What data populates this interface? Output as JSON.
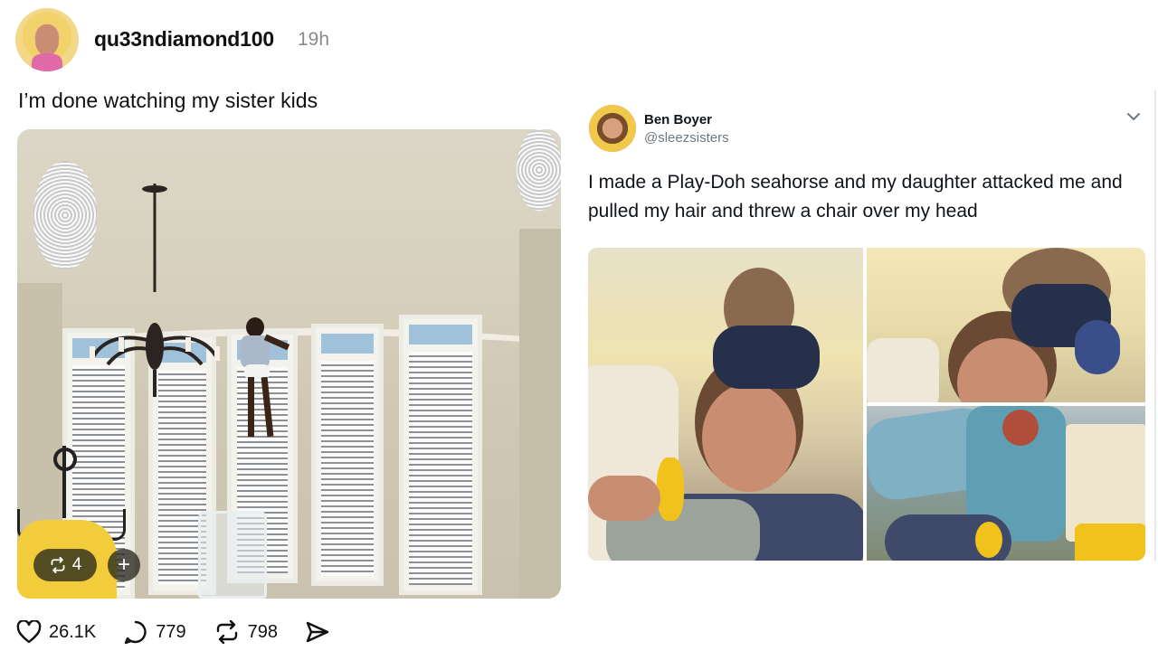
{
  "left_post": {
    "username": "qu33ndiamond100",
    "timestamp": "19h",
    "text": "I’m done watching my sister kids",
    "media_chip_reposts": "4",
    "media_chip_plus": "+",
    "actions": {
      "likes": "26.1K",
      "replies": "779",
      "reposts": "798"
    }
  },
  "right_tweet": {
    "display_name": "Ben Boyer",
    "handle": "@sleezsisters",
    "text": "I made a Play-Doh seahorse and my daughter attacked me and pulled my hair and threw a chair over my head"
  },
  "icons": {
    "like": "heart-icon",
    "reply": "speech-bubble-icon",
    "repost": "repost-arrows-icon",
    "share": "send-icon",
    "more": "chevron-down-icon"
  },
  "colors": {
    "background": "#ffffff",
    "text_primary": "#111111",
    "text_secondary": "#8a8a8a",
    "twitter_handle": "#6d7882"
  }
}
